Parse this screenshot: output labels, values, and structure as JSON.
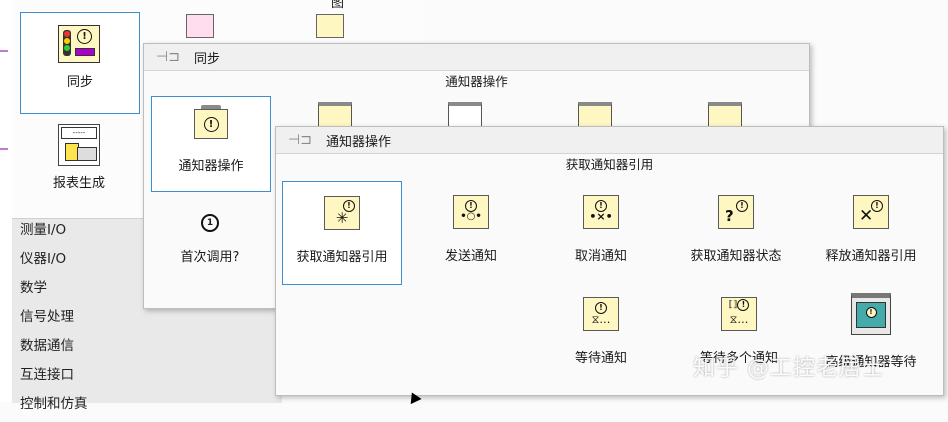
{
  "base_palette": {
    "top_partial_label": "图",
    "sync_label": "同步",
    "report_label": "报表生成",
    "categories": [
      "测量I/O",
      "仪器I/O",
      "数学",
      "信号处理",
      "数据通信",
      "互连接口",
      "控制和仿真"
    ]
  },
  "sync_palette": {
    "title": "同步",
    "subtitle": "通知器操作",
    "items": [
      {
        "label": "通知器操作"
      },
      {
        "label": "首次调用?"
      }
    ]
  },
  "notifier_palette": {
    "title": "通知器操作",
    "subtitle": "获取通知器引用",
    "items": [
      {
        "label": "获取通知器引用",
        "glyph": "✳"
      },
      {
        "label": "发送通知",
        "glyph": "•○•"
      },
      {
        "label": "取消通知",
        "glyph": "•×•"
      },
      {
        "label": "获取通知器状态",
        "glyph": "?"
      },
      {
        "label": "释放通知器引用",
        "glyph": "✕"
      },
      {
        "label": "等待通知",
        "glyph": "⧖…"
      },
      {
        "label": "等待多个通知",
        "glyph": "⧖…"
      },
      {
        "label": "高级通知器等待",
        "glyph": "⊞"
      }
    ]
  },
  "watermark": "知乎 @工控老居士",
  "colors": {
    "selection": "#3b8fd0",
    "icon_bg": "#fff7c2",
    "category_bg": "#e9e9e9"
  }
}
